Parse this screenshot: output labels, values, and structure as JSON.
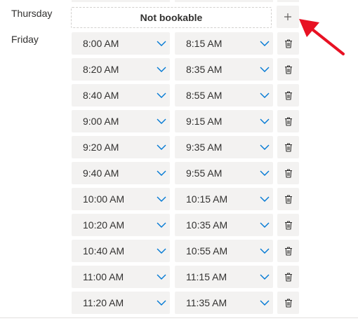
{
  "days": {
    "thursday": "Thursday",
    "friday": "Friday"
  },
  "thursday_status": "Not bookable",
  "friday_slots": [
    {
      "start": "8:00 AM",
      "end": "8:15 AM"
    },
    {
      "start": "8:20 AM",
      "end": "8:35 AM"
    },
    {
      "start": "8:40 AM",
      "end": "8:55 AM"
    },
    {
      "start": "9:00 AM",
      "end": "9:15 AM"
    },
    {
      "start": "9:20 AM",
      "end": "9:35 AM"
    },
    {
      "start": "9:40 AM",
      "end": "9:55 AM"
    },
    {
      "start": "10:00 AM",
      "end": "10:15 AM"
    },
    {
      "start": "10:20 AM",
      "end": "10:35 AM"
    },
    {
      "start": "10:40 AM",
      "end": "10:55 AM"
    },
    {
      "start": "11:00 AM",
      "end": "11:15 AM"
    },
    {
      "start": "11:20 AM",
      "end": "11:35 AM"
    }
  ],
  "icons": {
    "add": "plus-icon",
    "delete": "trash-icon",
    "dropdown": "chevron-down-icon",
    "annotation": "red-arrow"
  },
  "colors": {
    "field_bg": "#f3f2f1",
    "chevron": "#0078d4",
    "annotation_arrow": "#e81123"
  }
}
